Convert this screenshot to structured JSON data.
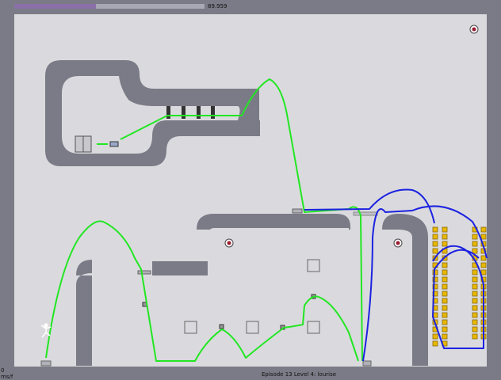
{
  "hud": {
    "timer": "89.959",
    "time_bar_fraction": 0.43,
    "speed_value": "0",
    "speed_unit": "ms/f",
    "episode_caption": "Episode 13 Level 4: lourise"
  },
  "colors": {
    "background": "#7b7b87",
    "floor": "#dadade",
    "wall": "#7b7b87",
    "time_bar": "#8a6fa8",
    "trail_green": "#22e622",
    "trail_blue": "#1c22e0",
    "gold": "#e8b800",
    "mine": "#9a1c30"
  },
  "entities": {
    "player": "ninja-figure",
    "exit_door": "exit-door",
    "exit_switch": "exit-switch",
    "gold_count_visible": 66,
    "mines": 3,
    "launch_pads": 4,
    "toggle_blocks": 4
  }
}
